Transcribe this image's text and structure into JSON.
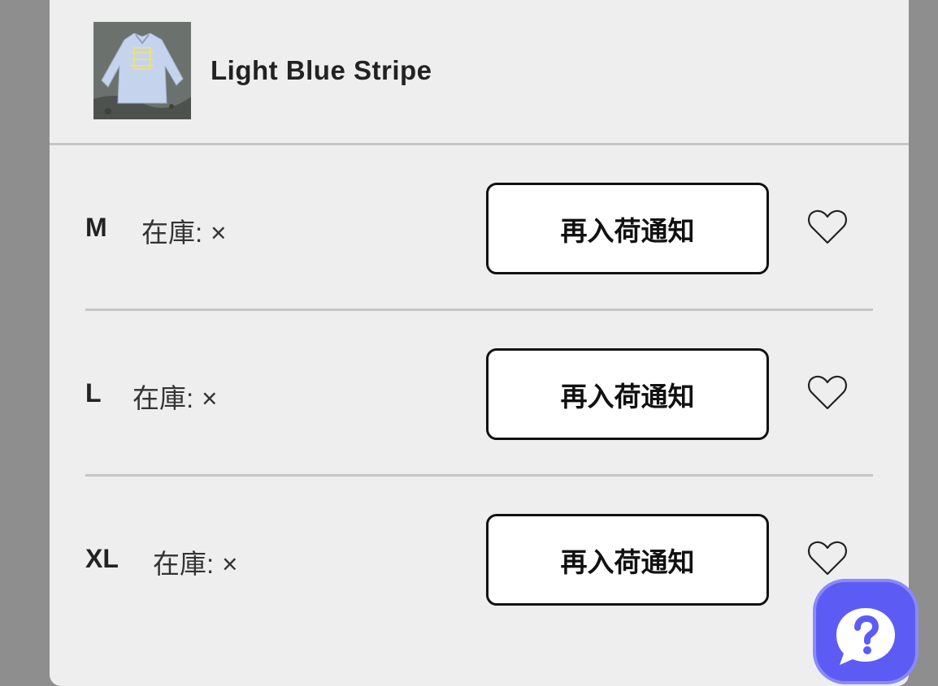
{
  "product": {
    "name": "Light Blue Stripe",
    "image_icon": "shirt-thumbnail"
  },
  "variants": [
    {
      "size": "M",
      "stock_label": "在庫:",
      "stock_value": "×",
      "button_label": "再入荷通知"
    },
    {
      "size": "L",
      "stock_label": "在庫:",
      "stock_value": "×",
      "button_label": "再入荷通知"
    },
    {
      "size": "XL",
      "stock_label": "在庫:",
      "stock_value": "×",
      "button_label": "再入荷通知"
    }
  ],
  "icons": {
    "favorite": "heart-outline-icon",
    "help": "question-chat-icon"
  },
  "colors": {
    "panel_bg": "#eeeeee",
    "backdrop": "#8e8e8e",
    "help_button": "#5c5cf5",
    "divider": "#c6c6c6"
  }
}
